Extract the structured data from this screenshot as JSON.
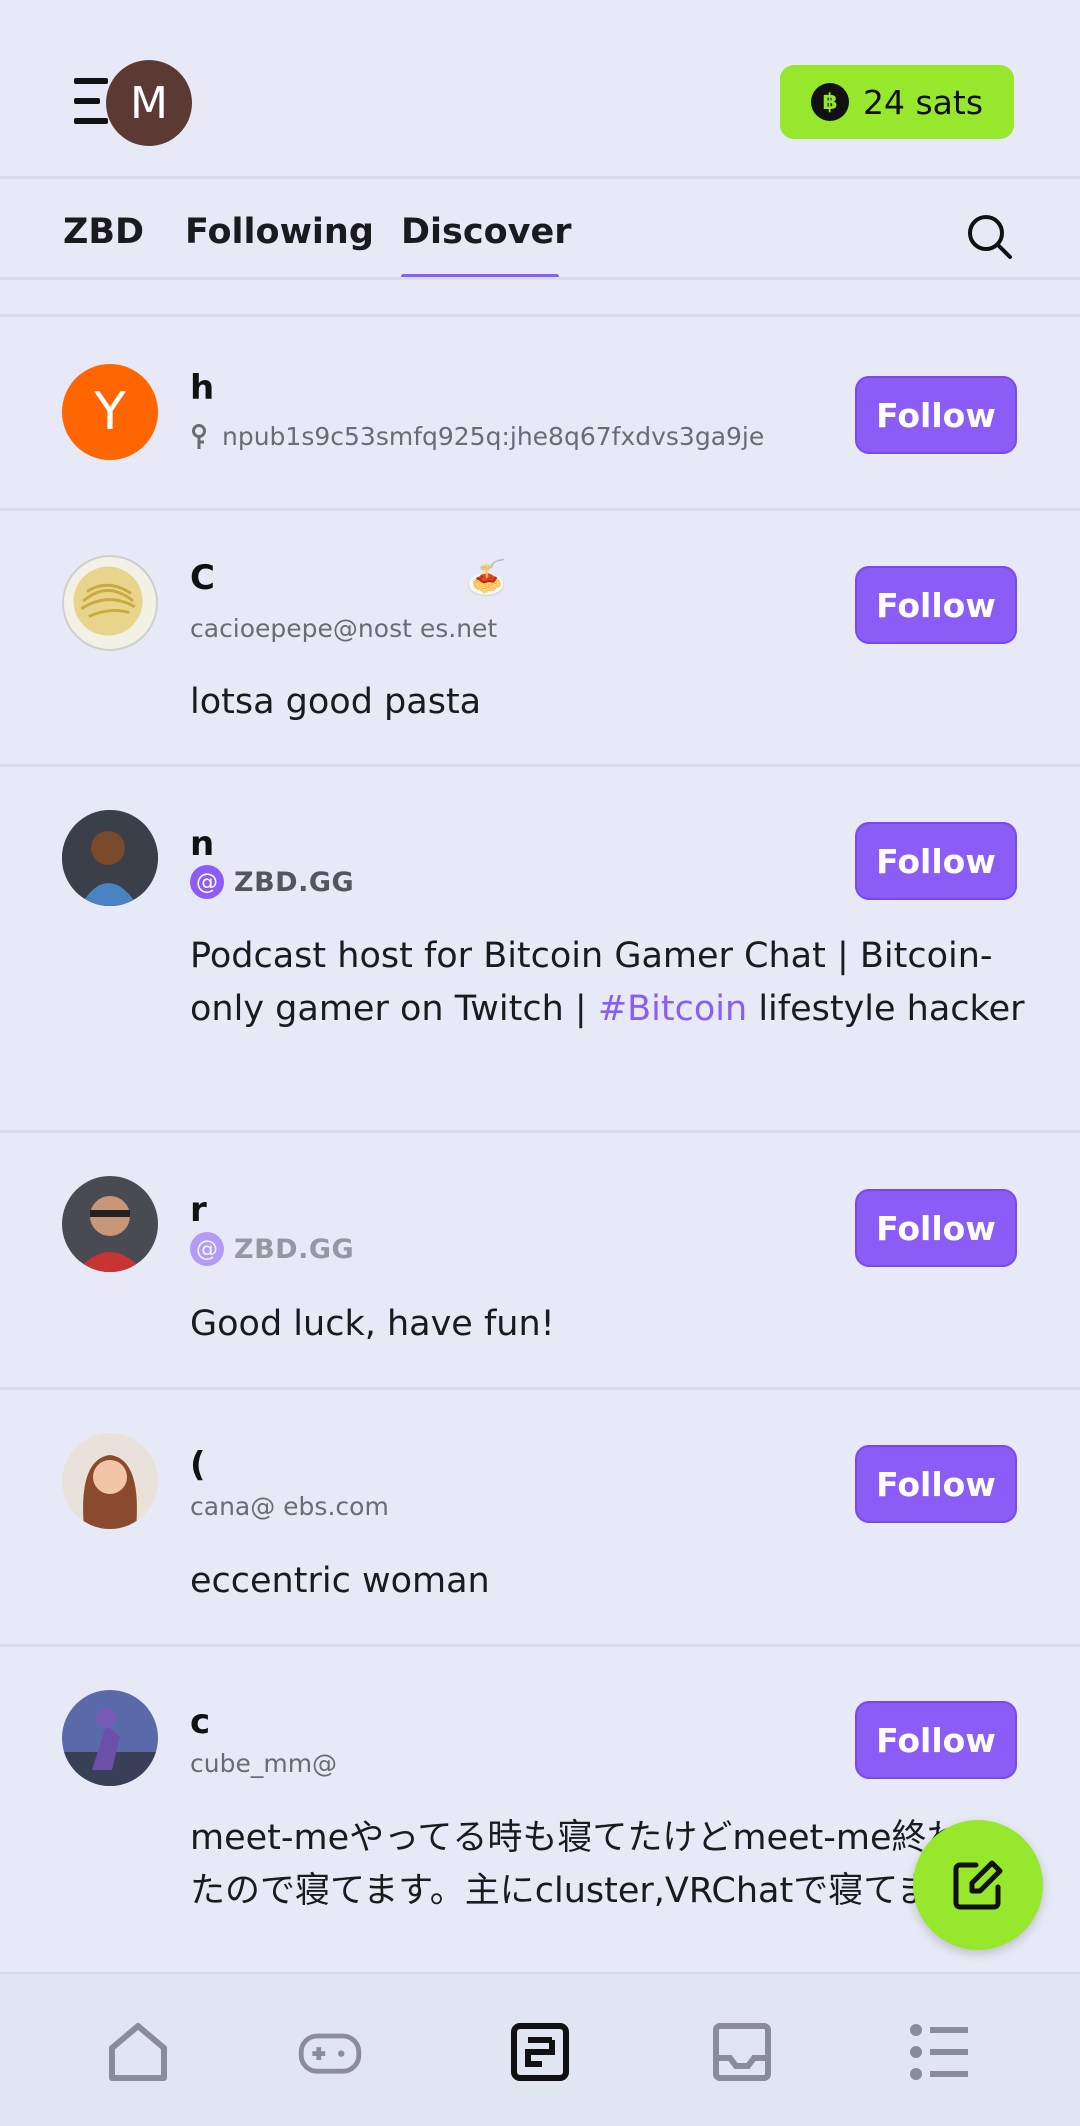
{
  "header": {
    "avatar_initial": "M",
    "sats_label": "24 sats",
    "sats_coin_glyph": "฿"
  },
  "tabs": [
    {
      "label": "ZBD"
    },
    {
      "label": "Following"
    },
    {
      "label": "Discover",
      "active": true
    }
  ],
  "feed": [
    {
      "name": "h",
      "avatar_initial": "Y",
      "handle": "npub1s9c53smfq925q:jhe8q67fxdvs3ga9je",
      "bio": "",
      "follow_label": "Follow"
    },
    {
      "name": "C",
      "name_emoji": "🍝",
      "handle": "cacioepepe@nost    es.net",
      "bio": "lotsa good pasta",
      "follow_label": "Follow"
    },
    {
      "name": "n",
      "badge_at": "@",
      "badge_text": "ZBD.GG",
      "bio_part1": "Podcast host for Bitcoin Gamer Chat | Bitcoin-only gamer on Twitch | ",
      "bio_tag": "#Bitcoin",
      "bio_part2": " lifestyle hacker",
      "follow_label": "Follow"
    },
    {
      "name": "r",
      "badge_at": "@",
      "badge_text": "ZBD.GG",
      "bio": "Good luck, have fun!",
      "follow_label": "Follow"
    },
    {
      "name": "(",
      "handle": "cana@        ebs.com",
      "bio": "eccentric woman",
      "follow_label": "Follow"
    },
    {
      "name": "c",
      "handle": "cube_mm@",
      "bio": "meet-meやってる時も寝てたけどmeet-me終わったので寝てます。主にcluster,VRChatで寝てます",
      "follow_label": "Follow"
    }
  ],
  "colors": {
    "background": "#E7EAF6",
    "accent_purple": "#8B5CF6",
    "accent_green": "#97E72D"
  },
  "icons": {
    "menu": "menu-icon",
    "search": "search-icon",
    "compose": "compose-icon",
    "nav": [
      "home-icon",
      "gamepad-icon",
      "feed-icon",
      "inbox-icon",
      "list-icon"
    ]
  }
}
